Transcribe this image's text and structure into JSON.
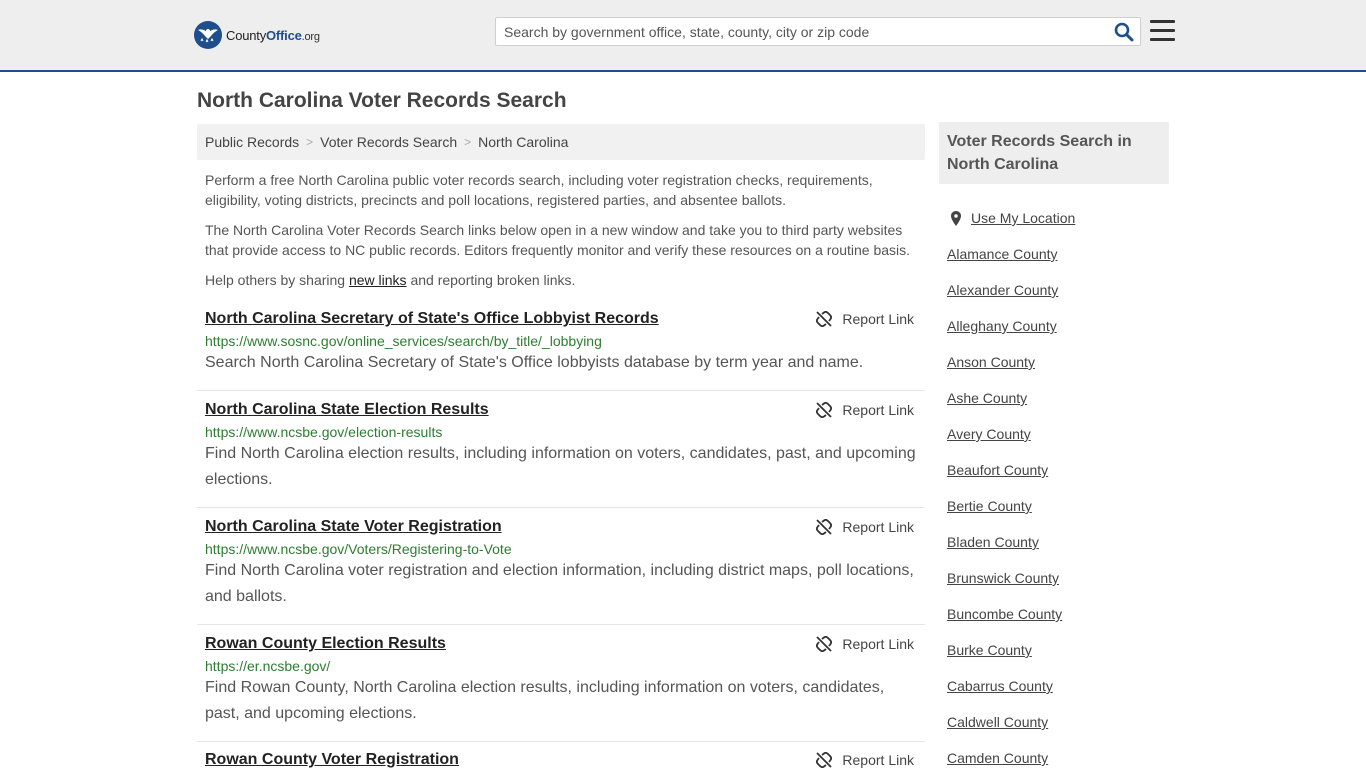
{
  "header": {
    "logo_text": "CountyOffice",
    "logo_tld": ".org",
    "search_placeholder": "Search by government office, state, county, city or zip code"
  },
  "page_title": "North Carolina Voter Records Search",
  "breadcrumb": [
    "Public Records",
    "Voter Records Search",
    "North Carolina"
  ],
  "intro": {
    "p1": "Perform a free North Carolina public voter records search, including voter registration checks, requirements, eligibility, voting districts, precincts and poll locations, registered parties, and absentee ballots.",
    "p2": "The North Carolina Voter Records Search links below open in a new window and take you to third party websites that provide access to NC public records. Editors frequently monitor and verify these resources on a routine basis.",
    "p3_before": "Help others by sharing ",
    "p3_link": "new links",
    "p3_after": " and reporting broken links."
  },
  "report_label": "Report Link",
  "listings": [
    {
      "title": "North Carolina Secretary of State's Office Lobbyist Records",
      "url": "https://www.sosnc.gov/online_services/search/by_title/_lobbying",
      "desc": "Search North Carolina Secretary of State's Office lobbyists database by term year and name."
    },
    {
      "title": "North Carolina State Election Results",
      "url": "https://www.ncsbe.gov/election-results",
      "desc": "Find North Carolina election results, including information on voters, candidates, past, and upcoming elections."
    },
    {
      "title": "North Carolina State Voter Registration",
      "url": "https://www.ncsbe.gov/Voters/Registering-to-Vote",
      "desc": "Find North Carolina voter registration and election information, including district maps, poll locations, and ballots."
    },
    {
      "title": "Rowan County Election Results",
      "url": "https://er.ncsbe.gov/",
      "desc": "Find Rowan County, North Carolina election results, including information on voters, candidates, past, and upcoming elections."
    },
    {
      "title": "Rowan County Voter Registration",
      "url": "",
      "desc": ""
    }
  ],
  "sidebar": {
    "heading": "Voter Records Search in North Carolina",
    "use_location": "Use My Location",
    "counties": [
      "Alamance County",
      "Alexander County",
      "Alleghany County",
      "Anson County",
      "Ashe County",
      "Avery County",
      "Beaufort County",
      "Bertie County",
      "Bladen County",
      "Brunswick County",
      "Buncombe County",
      "Burke County",
      "Cabarrus County",
      "Caldwell County",
      "Camden County"
    ]
  }
}
